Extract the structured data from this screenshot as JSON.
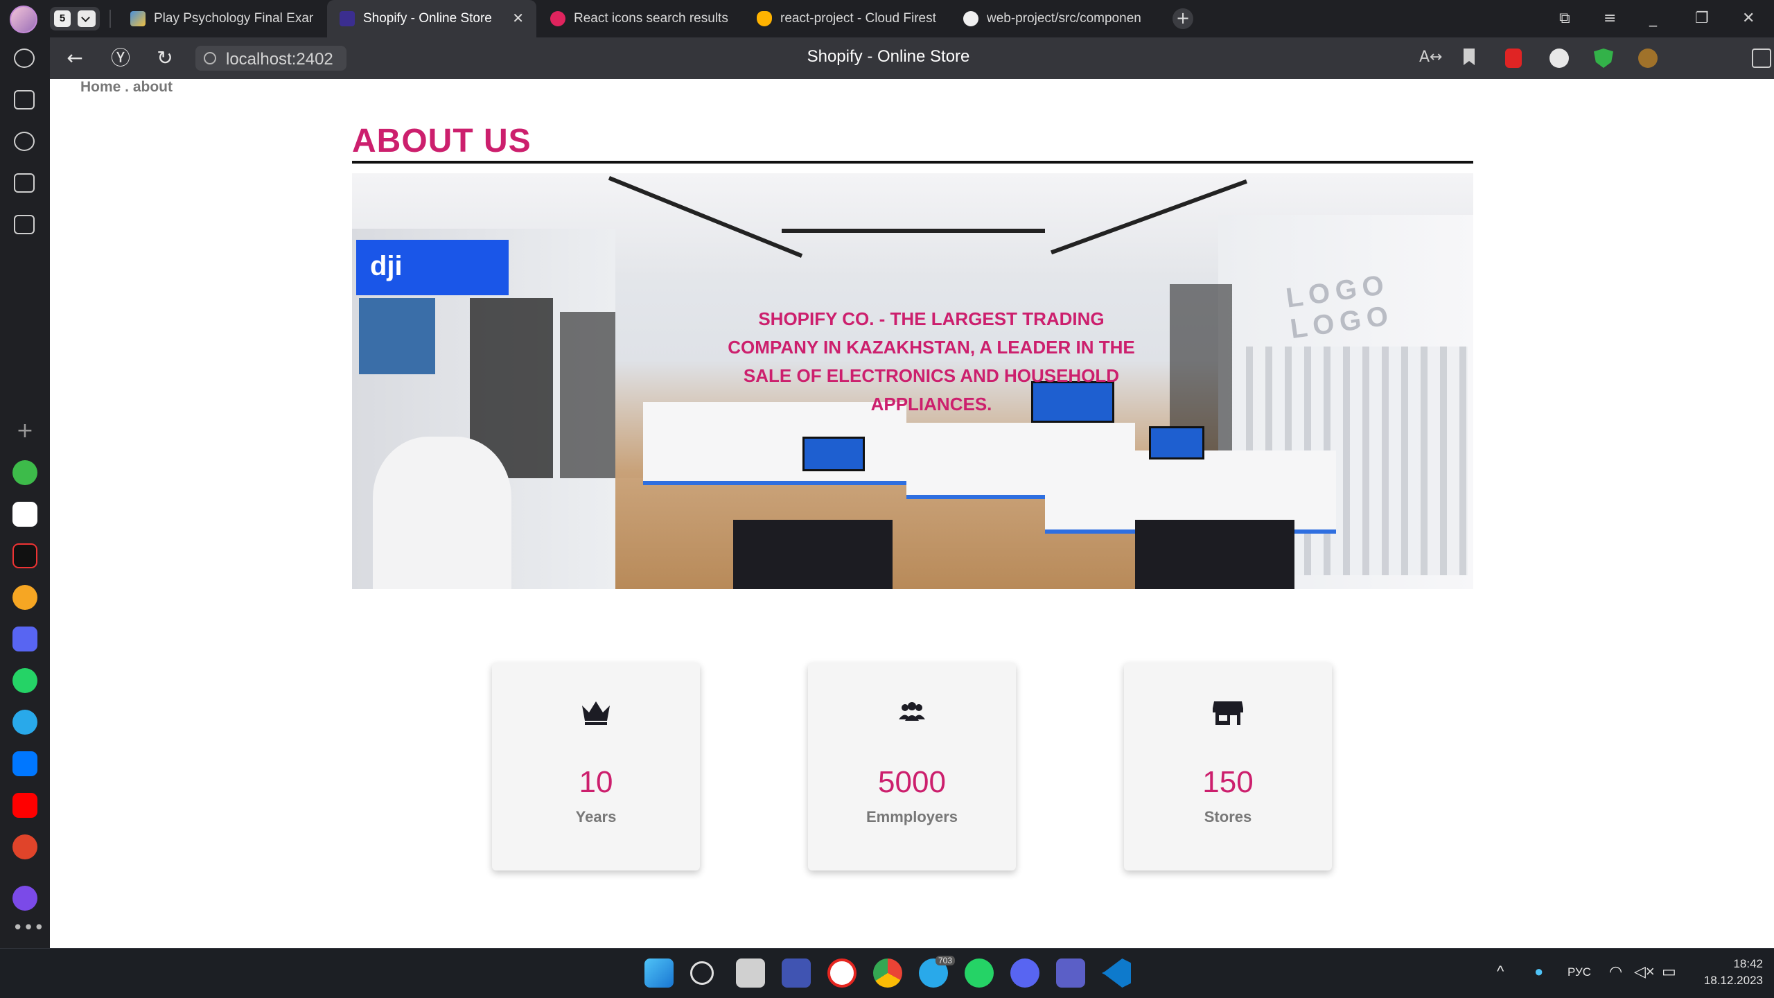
{
  "browser": {
    "tab_count": "5",
    "tabs": [
      {
        "title": "Play Psychology Final Exam"
      },
      {
        "title": "Shopify - Online Store",
        "active": true
      },
      {
        "title": "React icons search results"
      },
      {
        "title": "react-project - Cloud Firest"
      },
      {
        "title": "web-project/src/componen"
      }
    ],
    "address": "localhost:2402",
    "page_title": "Shopify - Online Store"
  },
  "page": {
    "breadcrumb": "Home . about",
    "title": "ABOUT US",
    "hero_text": "SHOPIFY CO. - THE LARGEST TRADING COMPANY IN KAZAKHSTAN, A LEADER IN THE SALE OF ELECTRONICS AND HOUSEHOLD APPLIANCES.",
    "hero_logo_text": "LOGO LOGO",
    "hero_brand_text": "dji",
    "stats": [
      {
        "icon": "crown-icon",
        "value": "10",
        "label": "Years"
      },
      {
        "icon": "users-icon",
        "value": "5000",
        "label": "Emmployers"
      },
      {
        "icon": "store-icon",
        "value": "150",
        "label": "Stores"
      }
    ]
  },
  "taskbar": {
    "language": "РУС",
    "time": "18:42",
    "date": "18.12.2023",
    "telegram_badge": "703"
  },
  "colors": {
    "accent": "#cc1f6d",
    "chrome_dark": "#1f2024",
    "chrome_bar": "#35363b"
  }
}
